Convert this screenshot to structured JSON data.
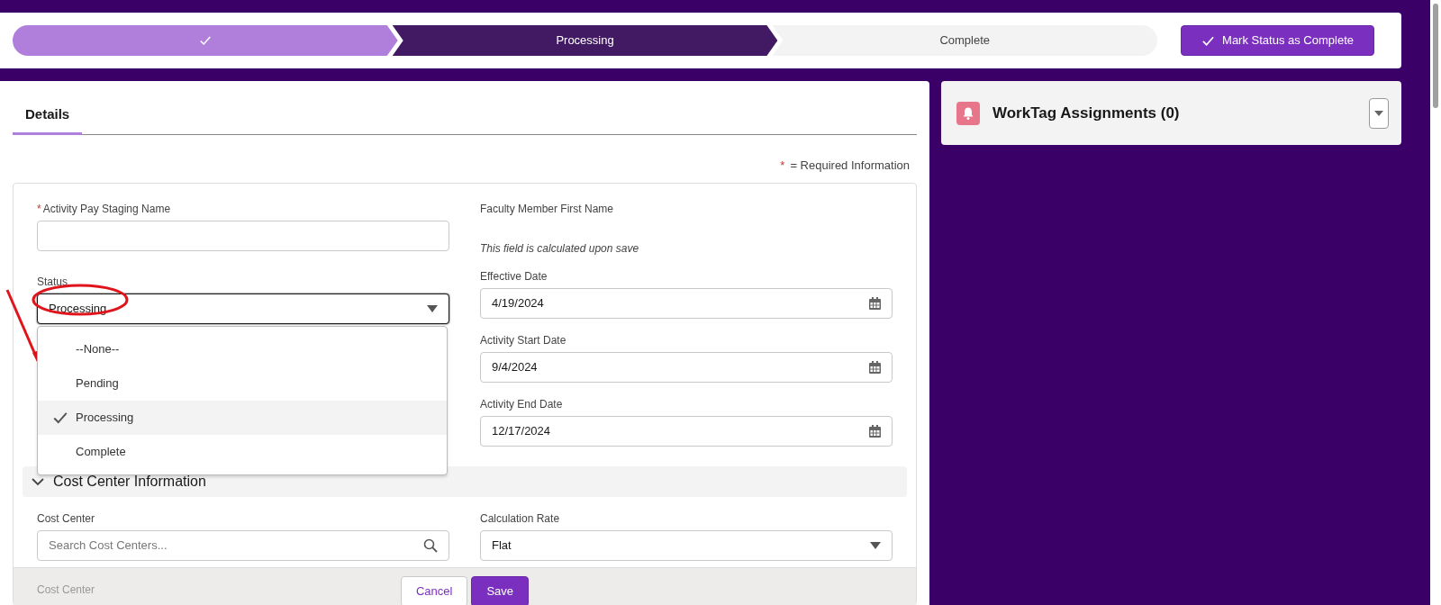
{
  "path": {
    "stages": [
      {
        "completed": true,
        "selected": false
      },
      {
        "completed": false,
        "selected": true,
        "label": "Processing"
      },
      {
        "completed": false,
        "selected": false,
        "label": "Complete"
      }
    ],
    "action_button": "Mark Status as Complete"
  },
  "tabs": [
    {
      "label": "Details",
      "selected": true
    }
  ],
  "required_note": {
    "mark": "*",
    "text": "= Required Information"
  },
  "left_fields": [
    {
      "kind": "text",
      "label": "Activity Pay Staging Name",
      "required": true
    },
    {
      "kind": "picklist",
      "label": "Status",
      "value": "Processing",
      "expanded": true,
      "options": [
        {
          "label": "--None--",
          "selected": false
        },
        {
          "label": "Pending",
          "selected": false
        },
        {
          "label": "Processing",
          "selected": true
        },
        {
          "label": "Complete",
          "selected": false
        }
      ]
    }
  ],
  "right_fields": [
    {
      "kind": "readonly",
      "label": "Faculty Member First Name",
      "help": "This field is calculated upon save"
    },
    {
      "kind": "date",
      "label": "Effective Date",
      "value": "4/19/2024"
    },
    {
      "kind": "date",
      "label": "Activity Start Date",
      "value": "9/4/2024"
    },
    {
      "kind": "date",
      "label": "Activity End Date",
      "value": "12/17/2024"
    }
  ],
  "section": {
    "title": "Cost Center Information",
    "expanded": true,
    "fields": [
      {
        "kind": "lookup",
        "label": "Cost Center",
        "placeholder": "Search Cost Centers..."
      },
      {
        "kind": "picklist",
        "label": "Calculation Rate",
        "value": "Flat"
      }
    ],
    "hidden_label": "Cost Center"
  },
  "footer": {
    "buttons": [
      {
        "label": "Cancel",
        "kind": "neutral"
      },
      {
        "label": "Save",
        "kind": "brand"
      }
    ]
  },
  "side_card": {
    "title": "WorkTag Assignments (0)"
  }
}
